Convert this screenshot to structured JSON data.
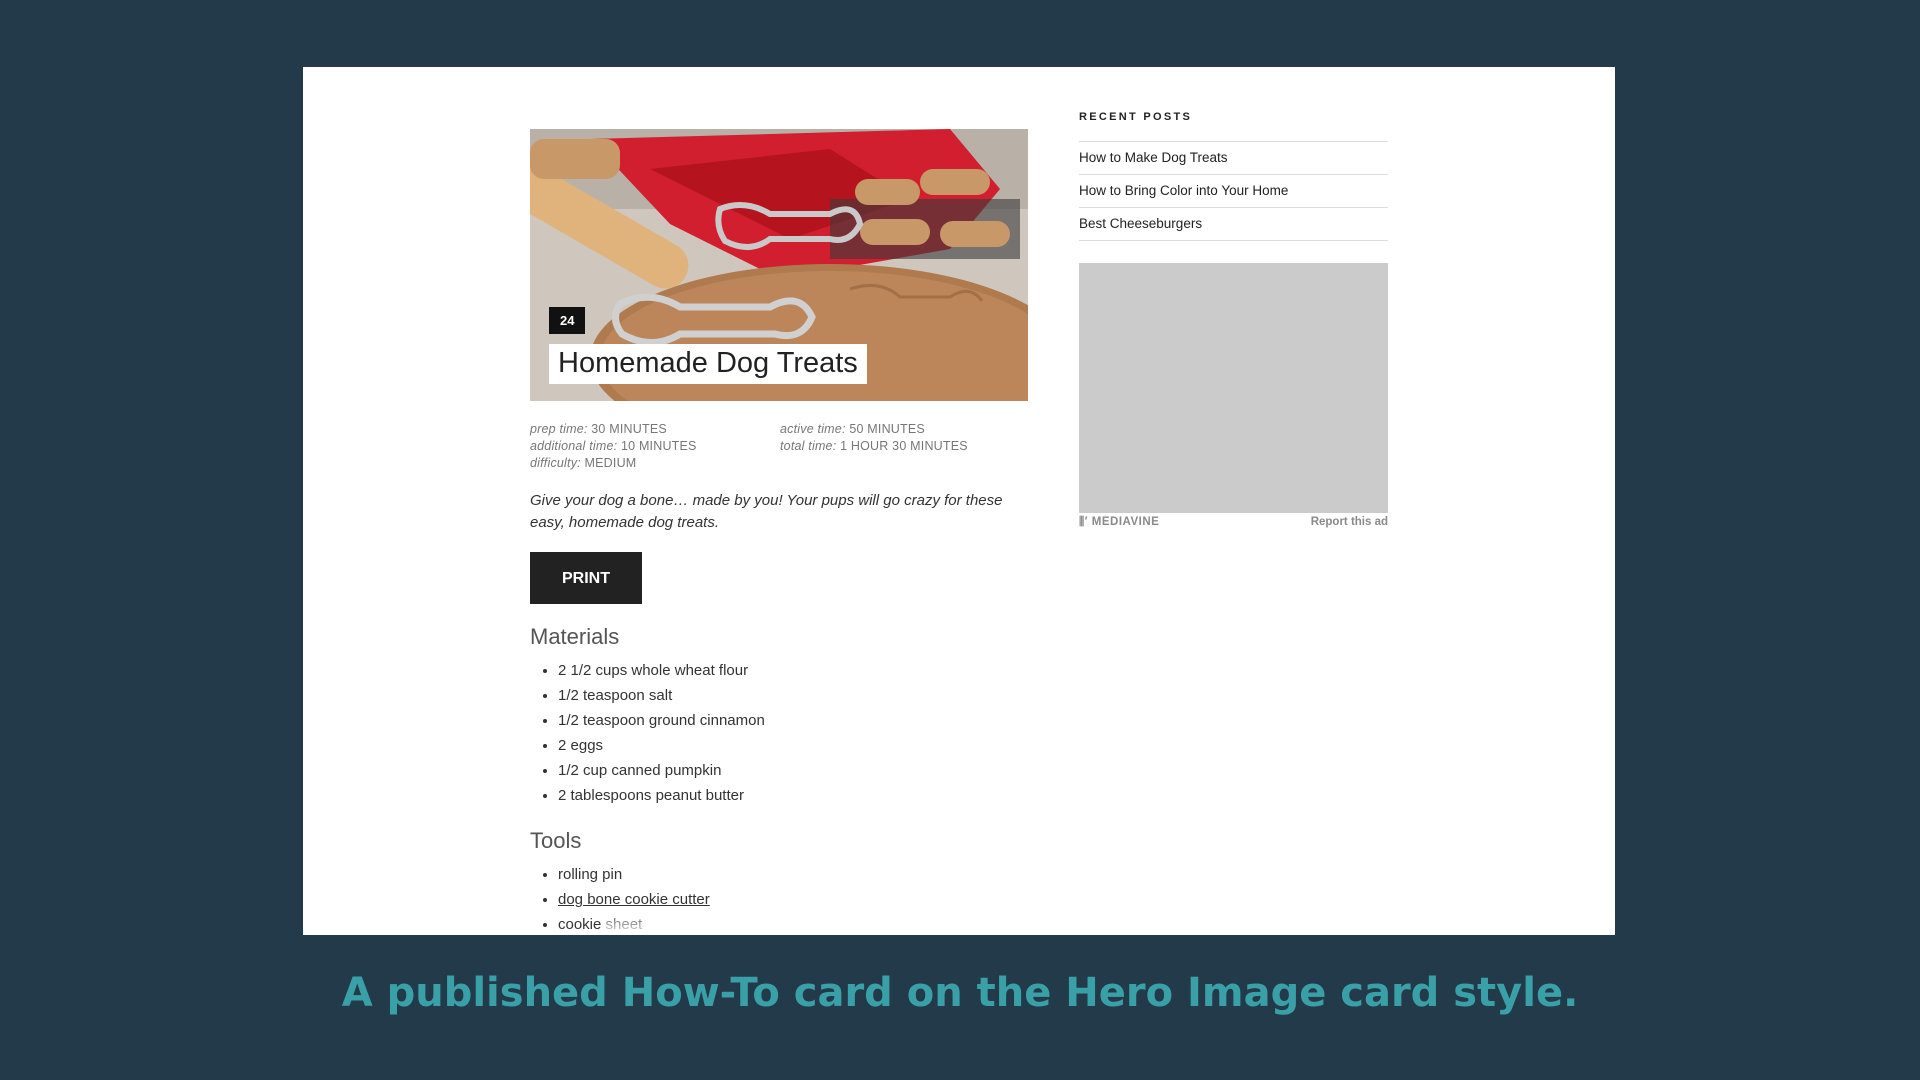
{
  "hero": {
    "date_badge": "24",
    "title": "Homemade Dog Treats"
  },
  "meta": {
    "prep_label": "prep time:",
    "prep_value": "30 MINUTES",
    "active_label": "active time:",
    "active_value": "50 MINUTES",
    "additional_label": "additional time:",
    "additional_value": "10 MINUTES",
    "total_label": "total time:",
    "total_value": "1 HOUR 30 MINUTES",
    "difficulty_label": "difficulty:",
    "difficulty_value": "MEDIUM"
  },
  "summary": "Give your dog a bone… made by you! Your pups will go crazy for these easy, homemade dog treats.",
  "print_label": "PRINT",
  "materials": {
    "title": "Materials",
    "items": [
      "2 1/2 cups whole wheat flour",
      "1/2 teaspoon salt",
      "1/2 teaspoon ground cinnamon",
      "2 eggs",
      "1/2 cup canned pumpkin",
      "2 tablespoons peanut butter"
    ]
  },
  "tools": {
    "title": "Tools",
    "items": [
      "rolling pin",
      "dog bone cookie cutter",
      "cookie sheet"
    ]
  },
  "sidebar": {
    "title": "RECENT POSTS",
    "posts": [
      "How to Make Dog Treats",
      "How to Bring Color into Your Home",
      "Best Cheeseburgers"
    ],
    "ad_brand": "MEDIAVINE",
    "ad_report": "Report this ad"
  },
  "caption": "A published How-To card on the Hero Image card style."
}
